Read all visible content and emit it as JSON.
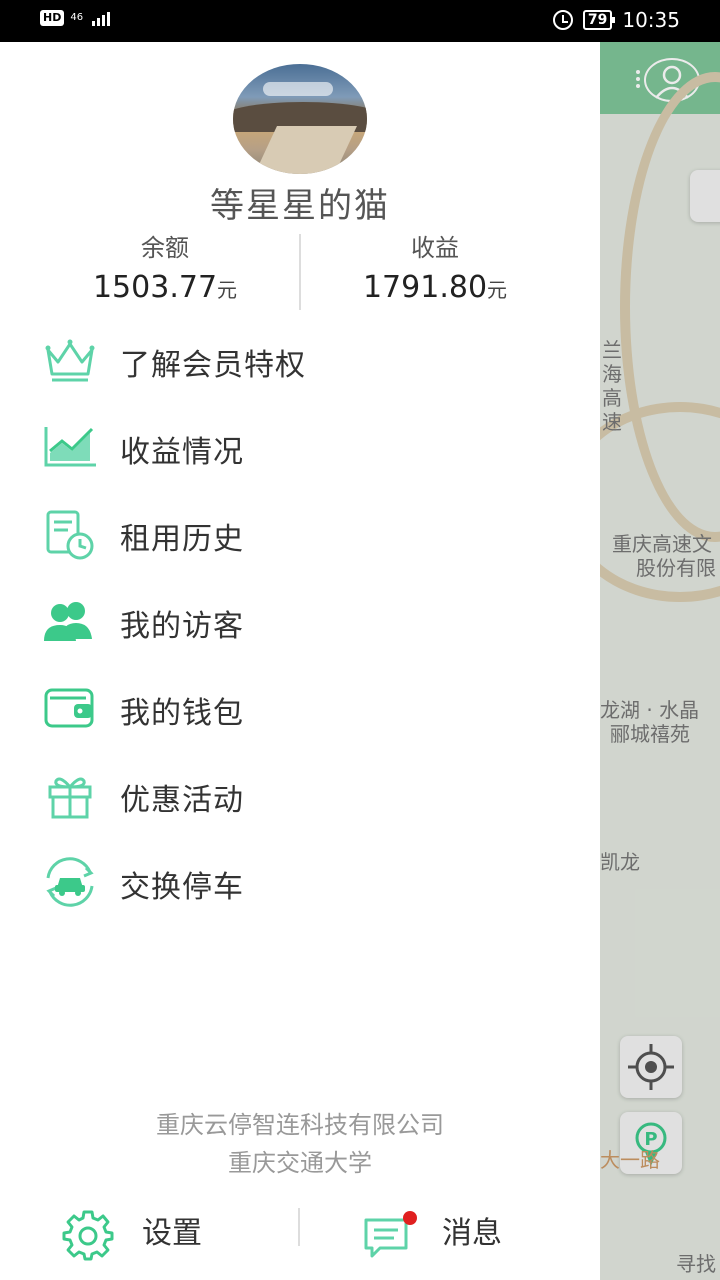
{
  "status_bar": {
    "hd": "HD",
    "network": "46",
    "battery": "79",
    "time": "10:35"
  },
  "profile": {
    "username": "等星星的猫",
    "balance_label": "余额",
    "balance_value": "1503.77",
    "balance_unit": "元",
    "income_label": "收益",
    "income_value": "1791.80",
    "income_unit": "元"
  },
  "menu": {
    "items": [
      {
        "label": "了解会员特权",
        "icon": "crown-icon"
      },
      {
        "label": "收益情况",
        "icon": "chart-icon"
      },
      {
        "label": "租用历史",
        "icon": "history-icon"
      },
      {
        "label": "我的访客",
        "icon": "visitors-icon"
      },
      {
        "label": "我的钱包",
        "icon": "wallet-icon"
      },
      {
        "label": "优惠活动",
        "icon": "gift-icon"
      },
      {
        "label": "交换停车",
        "icon": "car-swap-icon"
      }
    ]
  },
  "footer": {
    "line1": "重庆云停智连科技有限公司",
    "line2": "重庆交通大学"
  },
  "bottom_bar": {
    "settings_label": "设置",
    "messages_label": "消息"
  },
  "map": {
    "labels": [
      "重庆高速文",
      "股份有限",
      "龙湖 · 水晶",
      "郦城禧苑",
      "凯龙",
      "寻找"
    ],
    "road_label": "兰海高速",
    "route_label": "大一路"
  },
  "colors": {
    "accent": "#3cc98a",
    "accent_light": "#5ed3a8",
    "notification_dot": "#e02020",
    "map_header": "#7fc69a"
  }
}
